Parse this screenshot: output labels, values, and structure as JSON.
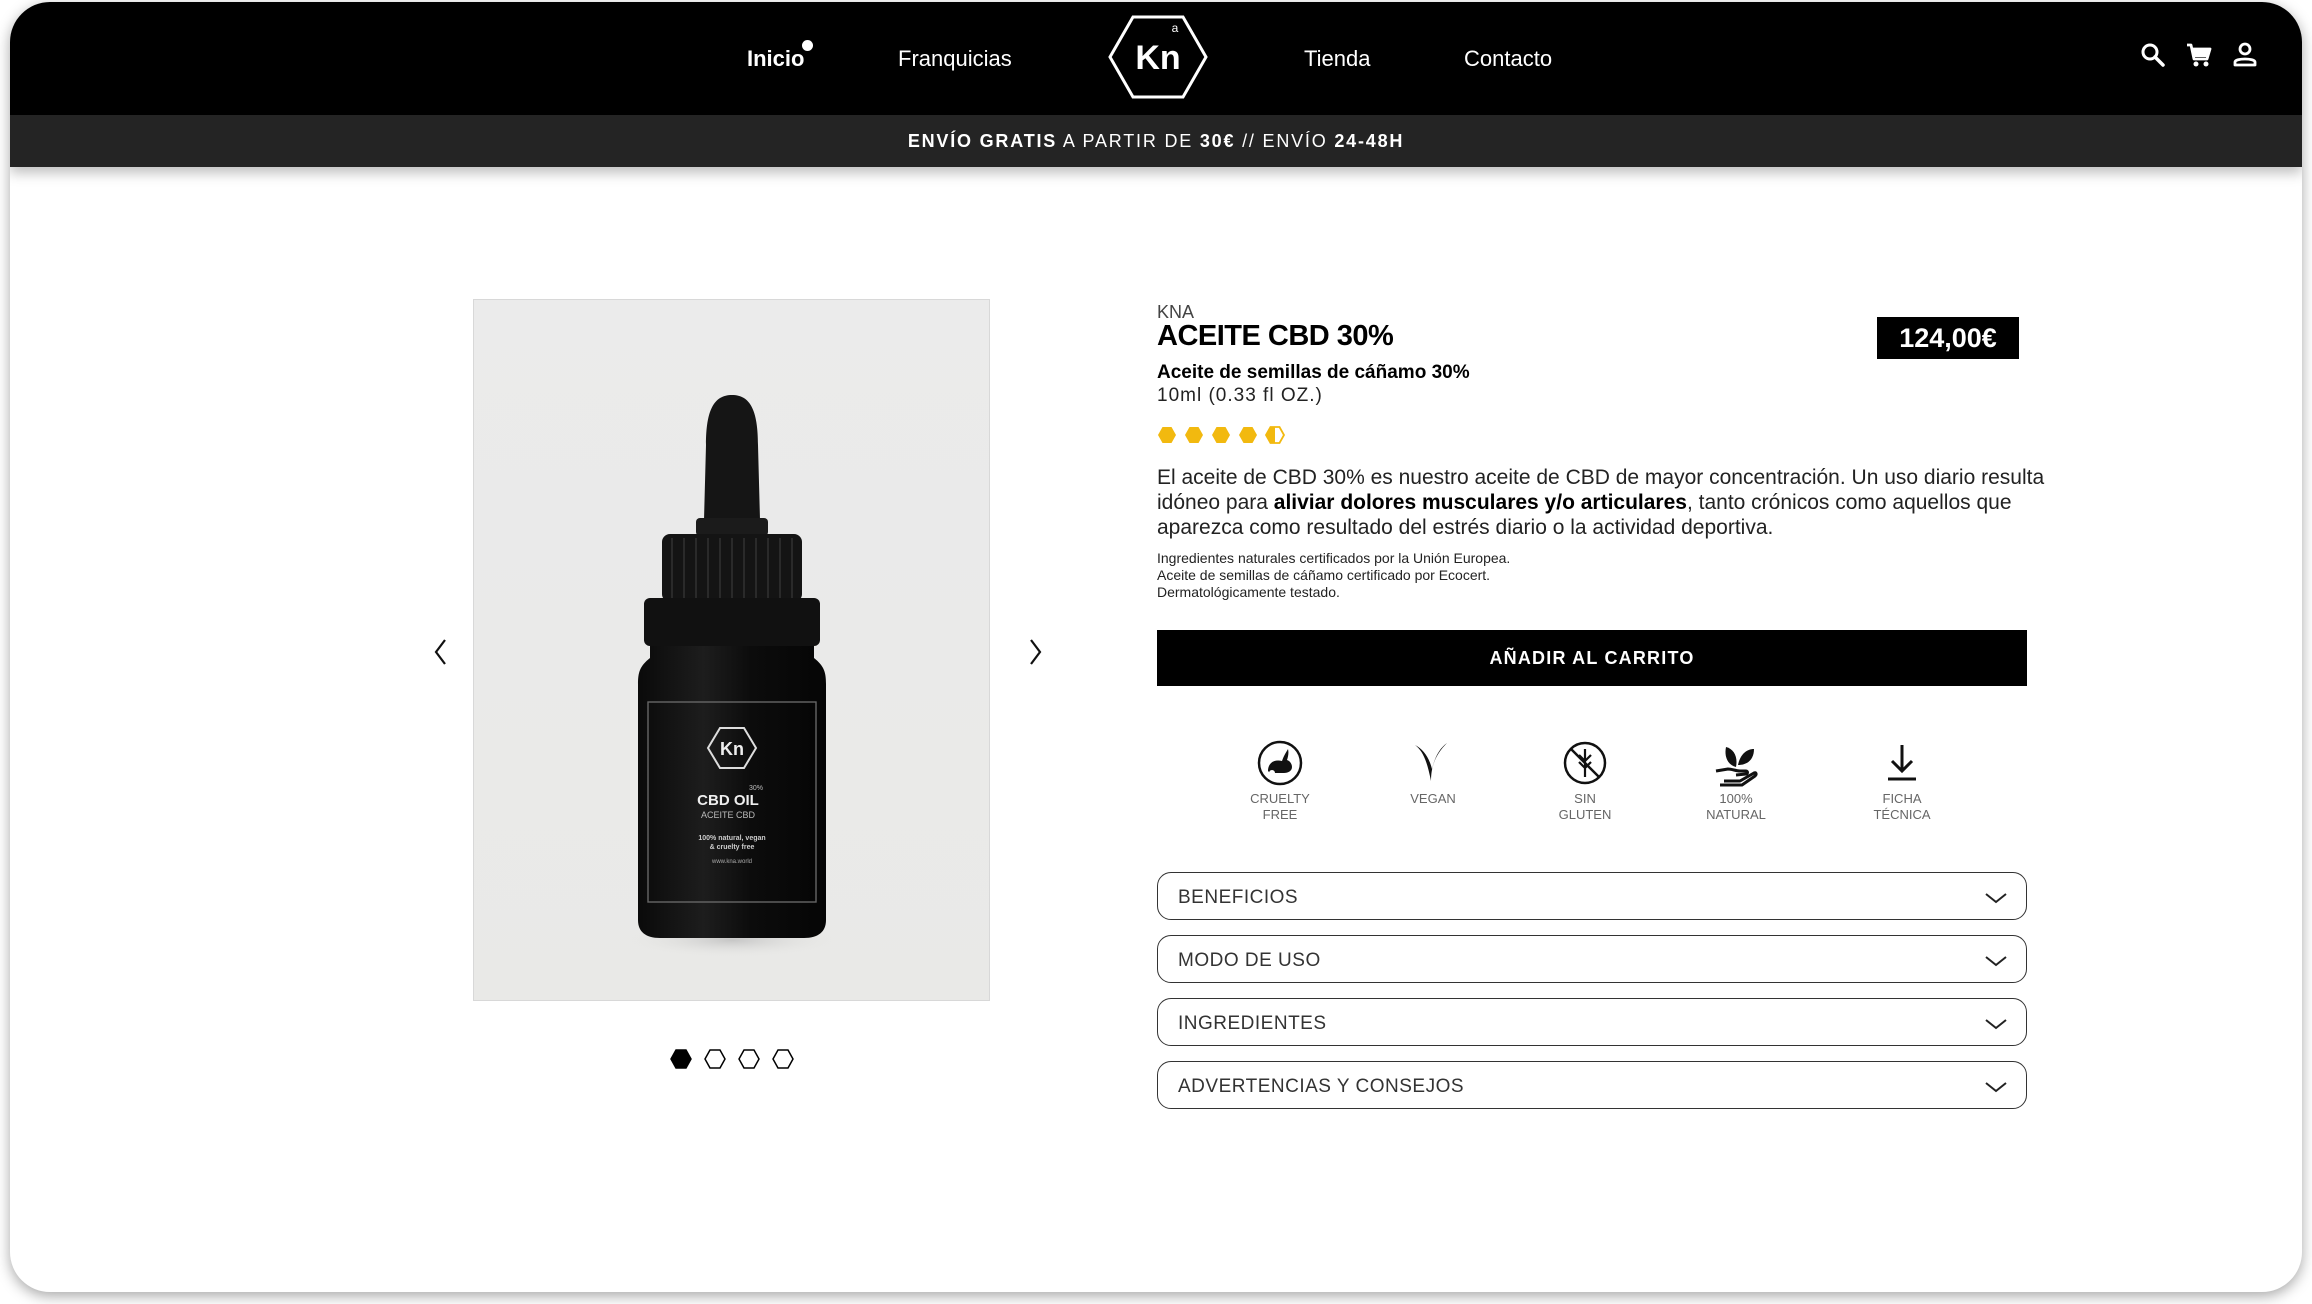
{
  "nav": {
    "links": [
      {
        "label": "Inicio",
        "active": true
      },
      {
        "label": "Franquicias"
      },
      {
        "label": "Tienda"
      },
      {
        "label": "Contacto"
      }
    ],
    "logo_text": "Kn",
    "logo_superscript": "a",
    "icons": [
      "search-icon",
      "cart-icon",
      "user-icon"
    ]
  },
  "shipping": {
    "bold_1": "ENVÍO GRATIS",
    "text_1": " A PARTIR DE ",
    "bold_2": "30€",
    "text_2": " // ENVÍO ",
    "bold_3": "24-48H"
  },
  "gallery": {
    "bottle_label": {
      "logo": "Kn",
      "percent": "30%",
      "name": "CBD OIL",
      "sub": "ACEITE CBD",
      "line1": "100% natural, vegan",
      "line2": "& cruelty free",
      "url": "www.kna.world"
    },
    "slide_count": 4,
    "active_slide": 1
  },
  "product": {
    "brand": "KNA",
    "title": "ACEITE CBD 30%",
    "price": "124,00€",
    "subtitle": "Aceite de semillas de cáñamo 30%",
    "volume": "10ml (0.33 fl OZ.)",
    "rating": 4.5,
    "rating_max": 5,
    "rating_color": "#f2b90f",
    "description": {
      "part1": "El aceite de CBD 30% es nuestro aceite de CBD de mayor concentración. Un uso diario resulta idóneo para ",
      "bold": "aliviar dolores musculares y/o articulares",
      "part2": ", tanto crónicos como aquellos que aparezca como resultado del estrés diario o la actividad deportiva."
    },
    "fine_print": [
      "Ingredientes naturales certificados por la Unión Europea.",
      "Aceite de semillas de cáñamo certificado por Ecocert.",
      "Dermatológicamente testado."
    ],
    "cart_button": "AÑADIR AL CARRITO",
    "badges": [
      {
        "icon": "cruelty-free-icon",
        "line1": "CRUELTY",
        "line2": "FREE"
      },
      {
        "icon": "vegan-icon",
        "line1": "VEGAN",
        "line2": ""
      },
      {
        "icon": "gluten-free-icon",
        "line1": "SIN",
        "line2": "GLUTEN"
      },
      {
        "icon": "natural-icon",
        "line1": "100%",
        "line2": "NATURAL"
      },
      {
        "icon": "download-icon",
        "line1": "FICHA",
        "line2": "TÉCNICA"
      }
    ],
    "accordions": [
      "BENEFICIOS",
      "MODO DE USO",
      "INGREDIENTES",
      "ADVERTENCIAS Y CONSEJOS"
    ]
  }
}
